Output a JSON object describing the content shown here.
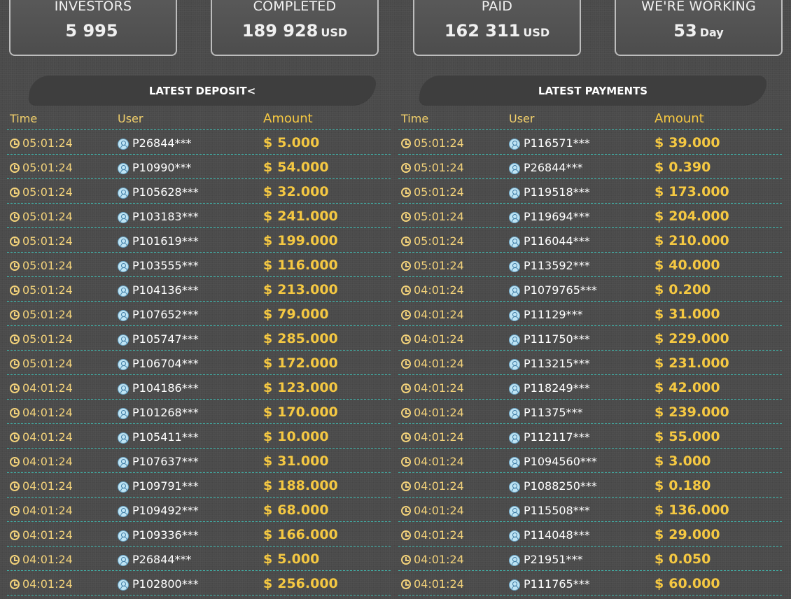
{
  "stats": [
    {
      "label": "INVESTORS",
      "value": "5 995",
      "unit": ""
    },
    {
      "label": "COMPLETED",
      "value": "189 928",
      "unit": "USD"
    },
    {
      "label": "PAID",
      "value": "162 311",
      "unit": "USD"
    },
    {
      "label": "WE'RE WORKING",
      "value": "53",
      "unit": "Day"
    }
  ],
  "deposits": {
    "title": "LATEST DEPOSIT<",
    "headers": {
      "time": "Time",
      "user": "User",
      "amount": "Amount"
    },
    "rows": [
      {
        "time": "05:01:24",
        "user": "P26844***",
        "amount": "5.000"
      },
      {
        "time": "05:01:24",
        "user": "P10990***",
        "amount": "54.000"
      },
      {
        "time": "05:01:24",
        "user": "P105628***",
        "amount": "32.000"
      },
      {
        "time": "05:01:24",
        "user": "P103183***",
        "amount": "241.000"
      },
      {
        "time": "05:01:24",
        "user": "P101619***",
        "amount": "199.000"
      },
      {
        "time": "05:01:24",
        "user": "P103555***",
        "amount": "116.000"
      },
      {
        "time": "05:01:24",
        "user": "P104136***",
        "amount": "213.000"
      },
      {
        "time": "05:01:24",
        "user": "P107652***",
        "amount": "79.000"
      },
      {
        "time": "05:01:24",
        "user": "P105747***",
        "amount": "285.000"
      },
      {
        "time": "05:01:24",
        "user": "P106704***",
        "amount": "172.000"
      },
      {
        "time": "04:01:24",
        "user": "P104186***",
        "amount": "123.000"
      },
      {
        "time": "04:01:24",
        "user": "P101268***",
        "amount": "170.000"
      },
      {
        "time": "04:01:24",
        "user": "P105411***",
        "amount": "10.000"
      },
      {
        "time": "04:01:24",
        "user": "P107637***",
        "amount": "31.000"
      },
      {
        "time": "04:01:24",
        "user": "P109791***",
        "amount": "188.000"
      },
      {
        "time": "04:01:24",
        "user": "P109492***",
        "amount": "68.000"
      },
      {
        "time": "04:01:24",
        "user": "P109336***",
        "amount": "166.000"
      },
      {
        "time": "04:01:24",
        "user": "P26844***",
        "amount": "5.000"
      },
      {
        "time": "04:01:24",
        "user": "P102800***",
        "amount": "256.000"
      }
    ]
  },
  "payments": {
    "title": "LATEST PAYMENTS",
    "headers": {
      "time": "Time",
      "user": "User",
      "amount": "Amount"
    },
    "rows": [
      {
        "time": "05:01:24",
        "user": "P116571***",
        "amount": "39.000"
      },
      {
        "time": "05:01:24",
        "user": "P26844***",
        "amount": "0.390"
      },
      {
        "time": "05:01:24",
        "user": "P119518***",
        "amount": "173.000"
      },
      {
        "time": "05:01:24",
        "user": "P119694***",
        "amount": "204.000"
      },
      {
        "time": "05:01:24",
        "user": "P116044***",
        "amount": "210.000"
      },
      {
        "time": "05:01:24",
        "user": "P113592***",
        "amount": "40.000"
      },
      {
        "time": "04:01:24",
        "user": "P1079765***",
        "amount": "0.200"
      },
      {
        "time": "04:01:24",
        "user": "P11129***",
        "amount": "31.000"
      },
      {
        "time": "04:01:24",
        "user": "P111750***",
        "amount": "229.000"
      },
      {
        "time": "04:01:24",
        "user": "P113215***",
        "amount": "231.000"
      },
      {
        "time": "04:01:24",
        "user": "P118249***",
        "amount": "42.000"
      },
      {
        "time": "04:01:24",
        "user": "P11375***",
        "amount": "239.000"
      },
      {
        "time": "04:01:24",
        "user": "P112117***",
        "amount": "55.000"
      },
      {
        "time": "04:01:24",
        "user": "P1094560***",
        "amount": "3.000"
      },
      {
        "time": "04:01:24",
        "user": "P1088250***",
        "amount": "0.180"
      },
      {
        "time": "04:01:24",
        "user": "P115508***",
        "amount": "136.000"
      },
      {
        "time": "04:01:24",
        "user": "P114048***",
        "amount": "29.000"
      },
      {
        "time": "04:01:24",
        "user": "P21951***",
        "amount": "0.050"
      },
      {
        "time": "04:01:24",
        "user": "P111765***",
        "amount": "60.000"
      }
    ]
  },
  "currency_symbol": "$",
  "colors": {
    "accent": "#f5c842",
    "divider": "#3fbcb2",
    "background": "#4a4a4a"
  }
}
